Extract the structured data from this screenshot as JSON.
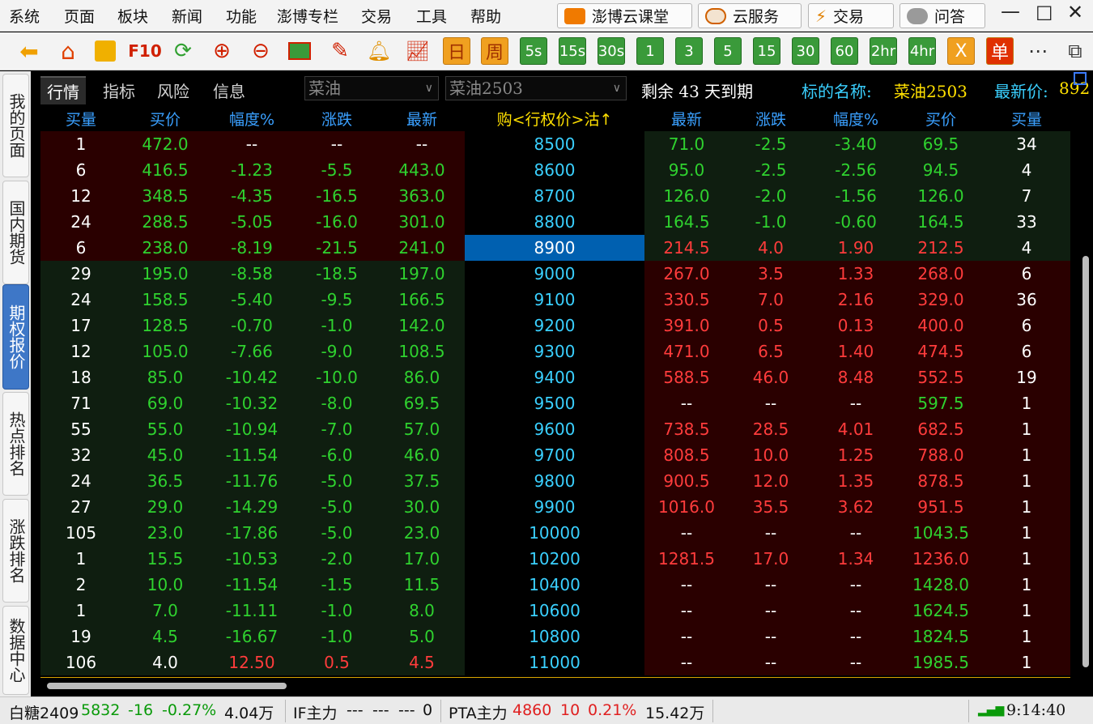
{
  "menu": [
    "系统",
    "页面",
    "板块",
    "新闻",
    "功能",
    "澎博专栏",
    "交易",
    "工具",
    "帮助"
  ],
  "top_buttons": [
    "澎博云课堂",
    "云服务",
    "交易",
    "问答"
  ],
  "window_controls": [
    "minimize-icon",
    "maximize-icon",
    "close-icon"
  ],
  "toolbar_text_buttons": [
    "F10",
    "日",
    "周",
    "5s",
    "15s",
    "30s",
    "1",
    "3",
    "5",
    "15",
    "30",
    "60",
    "2hr",
    "4hr",
    "X",
    "单"
  ],
  "side_tabs": [
    "我的页面",
    "国内期货",
    "期权报价",
    "热点排名",
    "涨跌排名",
    "数据中心"
  ],
  "sub_tabs": [
    "行情",
    "指标",
    "风险",
    "信息"
  ],
  "instrument_select": "菜油",
  "contract_select": "菜油2503",
  "remaining": "剩余 43 天到期",
  "underlying_label": "标的名称:",
  "underlying_value": "菜油2503",
  "latest_label": "最新价:",
  "latest_value": "892",
  "headers": [
    "买量",
    "买价",
    "幅度%",
    "涨跌",
    "最新",
    "购<行权价>沽↑",
    "最新",
    "涨跌",
    "幅度%",
    "买价",
    "买量"
  ],
  "colors": {
    "green": "#2fd22f",
    "red": "#ff3c3c",
    "white": "#ffffff",
    "cyan": "#3ad0ff",
    "header_blue": "#3aa0ff",
    "yellow": "#ffe000",
    "bg_dark_red": "#2a0000",
    "bg_dark_green": "#0f1e10",
    "selected_blue": "#0060b0"
  },
  "rows": [
    {
      "call": [
        "1",
        "472.0",
        "--",
        "--",
        "--"
      ],
      "strike": "8500",
      "put": [
        "71.0",
        "-2.5",
        "-3.40",
        "69.5",
        "34"
      ]
    },
    {
      "call": [
        "6",
        "416.5",
        "-1.23",
        "-5.5",
        "443.0"
      ],
      "strike": "8600",
      "put": [
        "95.0",
        "-2.5",
        "-2.56",
        "94.5",
        "4"
      ]
    },
    {
      "call": [
        "12",
        "348.5",
        "-4.35",
        "-16.5",
        "363.0"
      ],
      "strike": "8700",
      "put": [
        "126.0",
        "-2.0",
        "-1.56",
        "126.0",
        "7"
      ]
    },
    {
      "call": [
        "24",
        "288.5",
        "-5.05",
        "-16.0",
        "301.0"
      ],
      "strike": "8800",
      "put": [
        "164.5",
        "-1.0",
        "-0.60",
        "164.5",
        "33"
      ]
    },
    {
      "call": [
        "6",
        "238.0",
        "-8.19",
        "-21.5",
        "241.0"
      ],
      "strike": "8900",
      "put": [
        "214.5",
        "4.0",
        "1.90",
        "212.5",
        "4"
      ]
    },
    {
      "call": [
        "29",
        "195.0",
        "-8.58",
        "-18.5",
        "197.0"
      ],
      "strike": "9000",
      "put": [
        "267.0",
        "3.5",
        "1.33",
        "268.0",
        "6"
      ]
    },
    {
      "call": [
        "24",
        "158.5",
        "-5.40",
        "-9.5",
        "166.5"
      ],
      "strike": "9100",
      "put": [
        "330.5",
        "7.0",
        "2.16",
        "329.0",
        "36"
      ]
    },
    {
      "call": [
        "17",
        "128.5",
        "-0.70",
        "-1.0",
        "142.0"
      ],
      "strike": "9200",
      "put": [
        "391.0",
        "0.5",
        "0.13",
        "400.0",
        "6"
      ]
    },
    {
      "call": [
        "12",
        "105.0",
        "-7.66",
        "-9.0",
        "108.5"
      ],
      "strike": "9300",
      "put": [
        "471.0",
        "6.5",
        "1.40",
        "474.5",
        "6"
      ]
    },
    {
      "call": [
        "18",
        "85.0",
        "-10.42",
        "-10.0",
        "86.0"
      ],
      "strike": "9400",
      "put": [
        "588.5",
        "46.0",
        "8.48",
        "552.5",
        "19"
      ]
    },
    {
      "call": [
        "71",
        "69.0",
        "-10.32",
        "-8.0",
        "69.5"
      ],
      "strike": "9500",
      "put": [
        "--",
        "--",
        "--",
        "597.5",
        "1"
      ]
    },
    {
      "call": [
        "55",
        "55.0",
        "-10.94",
        "-7.0",
        "57.0"
      ],
      "strike": "9600",
      "put": [
        "738.5",
        "28.5",
        "4.01",
        "682.5",
        "1"
      ]
    },
    {
      "call": [
        "32",
        "45.0",
        "-11.54",
        "-6.0",
        "46.0"
      ],
      "strike": "9700",
      "put": [
        "808.5",
        "10.0",
        "1.25",
        "788.0",
        "1"
      ]
    },
    {
      "call": [
        "24",
        "36.5",
        "-11.76",
        "-5.0",
        "37.5"
      ],
      "strike": "9800",
      "put": [
        "900.5",
        "12.0",
        "1.35",
        "878.5",
        "1"
      ]
    },
    {
      "call": [
        "27",
        "29.0",
        "-14.29",
        "-5.0",
        "30.0"
      ],
      "strike": "9900",
      "put": [
        "1016.0",
        "35.5",
        "3.62",
        "951.5",
        "1"
      ]
    },
    {
      "call": [
        "105",
        "23.0",
        "-17.86",
        "-5.0",
        "23.0"
      ],
      "strike": "10000",
      "put": [
        "--",
        "--",
        "--",
        "1043.5",
        "1"
      ]
    },
    {
      "call": [
        "1",
        "15.5",
        "-10.53",
        "-2.0",
        "17.0"
      ],
      "strike": "10200",
      "put": [
        "1281.5",
        "17.0",
        "1.34",
        "1236.0",
        "1"
      ]
    },
    {
      "call": [
        "2",
        "10.0",
        "-11.54",
        "-1.5",
        "11.5"
      ],
      "strike": "10400",
      "put": [
        "--",
        "--",
        "--",
        "1428.0",
        "1"
      ]
    },
    {
      "call": [
        "1",
        "7.0",
        "-11.11",
        "-1.0",
        "8.0"
      ],
      "strike": "10600",
      "put": [
        "--",
        "--",
        "--",
        "1624.5",
        "1"
      ]
    },
    {
      "call": [
        "19",
        "4.5",
        "-16.67",
        "-1.0",
        "5.0"
      ],
      "strike": "10800",
      "put": [
        "--",
        "--",
        "--",
        "1824.5",
        "1"
      ]
    },
    {
      "call": [
        "106",
        "4.0",
        "12.50",
        "0.5",
        "4.5"
      ],
      "strike": "11000",
      "put": [
        "--",
        "--",
        "--",
        "1985.5",
        "1"
      ]
    }
  ],
  "status": {
    "sugar_name": "白糖2409",
    "sugar_price": "5832",
    "sugar_change": "-16",
    "sugar_pct": "-0.27%",
    "sugar_vol": "4.04万",
    "if_name": "IF主力",
    "if_price": "---",
    "if_change": "---",
    "if_pct": "---",
    "if_vol": "0",
    "pta_name": "PTA主力",
    "pta_price": "4860",
    "pta_change": "10",
    "pta_pct": "0.21%",
    "pta_vol": "15.42万",
    "time": "9:14:40"
  }
}
